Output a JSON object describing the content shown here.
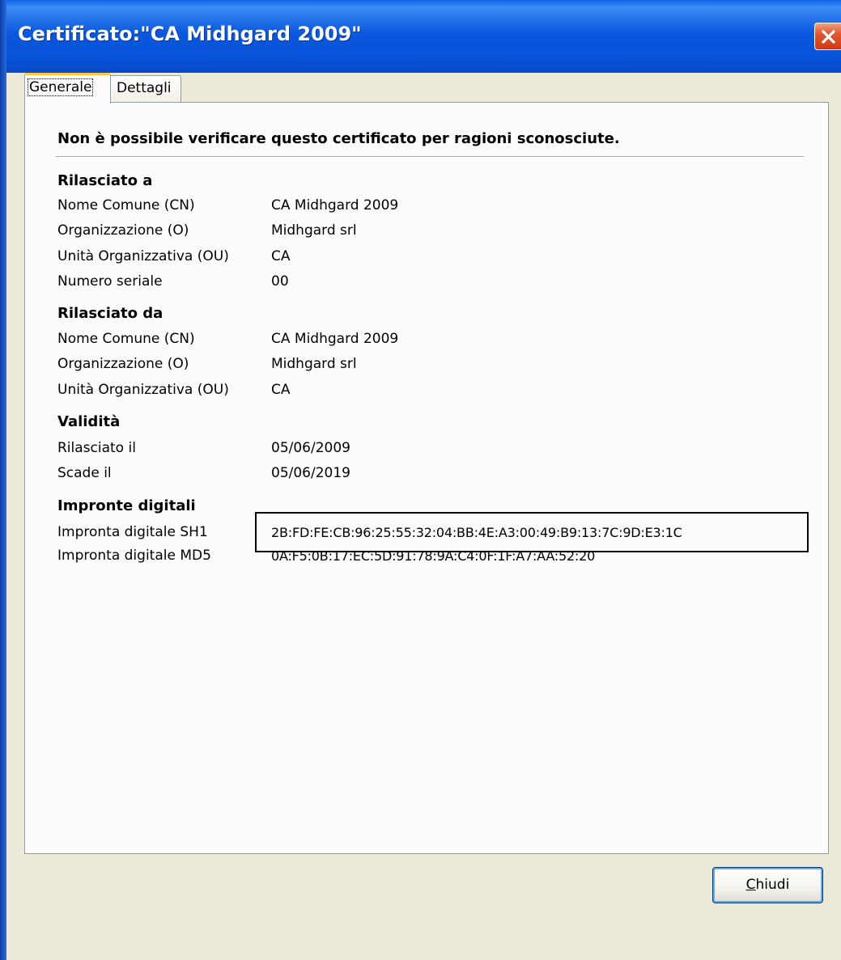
{
  "window": {
    "title": "Certificato:\"CA Midhgard 2009\""
  },
  "tabs": [
    {
      "label": "Generale",
      "selected": true
    },
    {
      "label": "Dettagli",
      "selected": false
    }
  ],
  "general": {
    "headline": "Non è possibile verificare questo certificato per ragioni sconosciute.",
    "issued_to": {
      "title": "Rilasciato a",
      "rows": [
        {
          "label": "Nome Comune (CN)",
          "value": "CA Midhgard 2009"
        },
        {
          "label": "Organizzazione (O)",
          "value": "Midhgard srl"
        },
        {
          "label": "Unità Organizzativa (OU)",
          "value": "CA"
        },
        {
          "label": "Numero seriale",
          "value": "00"
        }
      ]
    },
    "issued_by": {
      "title": "Rilasciato da",
      "rows": [
        {
          "label": "Nome Comune (CN)",
          "value": "CA Midhgard 2009"
        },
        {
          "label": "Organizzazione (O)",
          "value": "Midhgard srl"
        },
        {
          "label": "Unità Organizzativa (OU)",
          "value": "CA"
        }
      ]
    },
    "validity": {
      "title": "Validità",
      "rows": [
        {
          "label": "Rilasciato il",
          "value": "05/06/2009"
        },
        {
          "label": "Scade il",
          "value": "05/06/2019"
        }
      ]
    },
    "fingerprints": {
      "title": "Impronte digitali",
      "rows": [
        {
          "label": "Impronta digitale SH1",
          "value": "2B:FD:FE:CB:96:25:55:32:04:BB:4E:A3:00:49:B9:13:7C:9D:E3:1C"
        },
        {
          "label": "Impronta digitale MD5",
          "value": "0A:F5:0B:17:EC:5D:91:78:9A:C4:0F:1F:A7:AA:52:20"
        }
      ]
    }
  },
  "buttons": {
    "close_first": "C",
    "close_rest": "hiudi"
  },
  "icons": {
    "close": "close-icon"
  },
  "colors": {
    "titlebar": "#0b58de",
    "close_button": "#e2582e",
    "dialog_bg": "#ece9d8",
    "panel_bg": "#fcfcfe",
    "tab_highlight": "#ffc83c"
  }
}
